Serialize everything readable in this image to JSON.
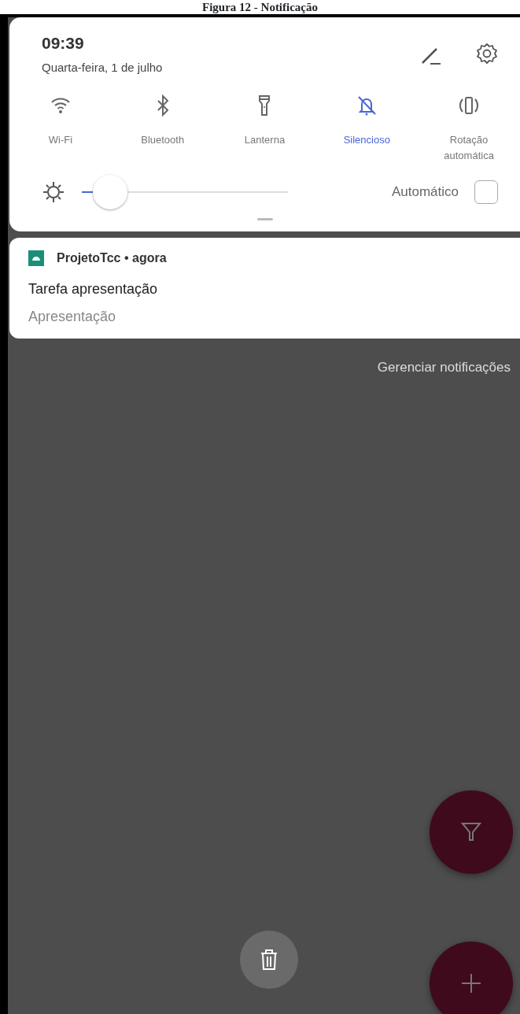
{
  "caption": "Figura 12 - Notificação",
  "header": {
    "time": "09:39",
    "date": "Quarta-feira, 1 de julho"
  },
  "tiles": [
    {
      "kind": "wifi",
      "label": "Wi-Fi",
      "selected": false
    },
    {
      "kind": "bluetooth",
      "label": "Bluetooth",
      "selected": false
    },
    {
      "kind": "flashlight",
      "label": "Lanterna",
      "selected": false
    },
    {
      "kind": "silent",
      "label": "Silencioso",
      "selected": true
    },
    {
      "kind": "rotation",
      "label": "Rotação automática",
      "selected": false
    }
  ],
  "brightness": {
    "level": 0.1,
    "auto_label": "Automático",
    "checked": false
  },
  "notification": {
    "app": "ProjetoTcc",
    "separator": "•",
    "time": "agora",
    "title": "Tarefa apresentação",
    "text": "Apresentação"
  },
  "manage_label": "Gerenciar notificações"
}
